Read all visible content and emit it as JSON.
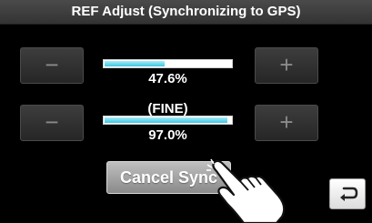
{
  "window": {
    "title": "REF Adjust (Synchronizing to GPS)"
  },
  "adjust_rows": [
    {
      "minus_label": "−",
      "plus_label": "+",
      "level_fraction": 0.476,
      "value_text": "47.6%"
    },
    {
      "mode_label": "(FINE)",
      "minus_label": "−",
      "plus_label": "+",
      "level_fraction": 0.97,
      "value_text": "97.0%"
    }
  ],
  "actions": {
    "cancel_label": "Cancel Sync"
  },
  "icons": {
    "back": "return-arrow-icon",
    "pointer": "pointing-hand-icon"
  },
  "colors": {
    "bar_fill": "#3cc6e2",
    "background": "#000000"
  }
}
